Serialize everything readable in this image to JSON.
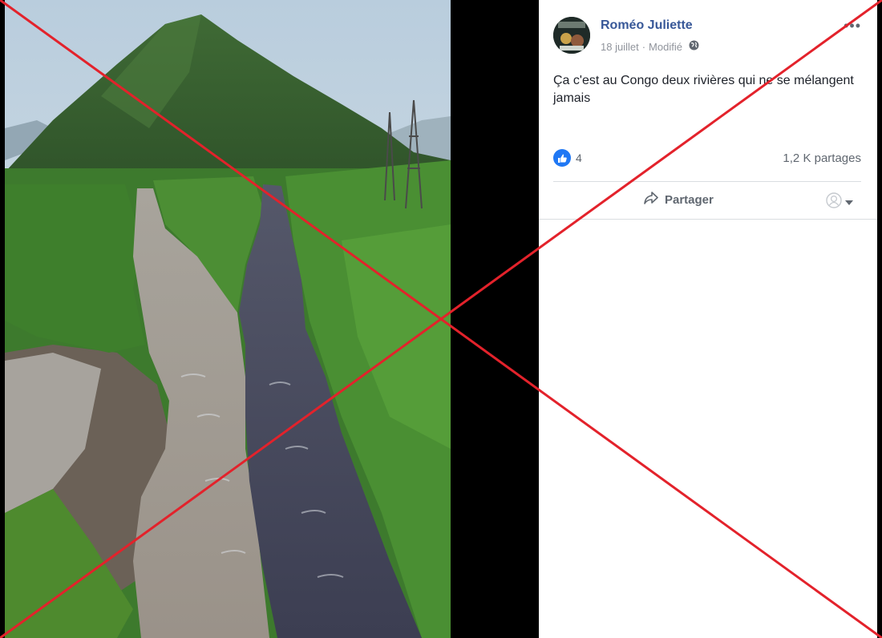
{
  "post": {
    "author": "Roméo Juliette",
    "date": "18 juillet",
    "separator": "·",
    "edited": "Modifié",
    "privacy_icon": "globe-icon",
    "more_label": "•••",
    "text": "Ça c'est au Congo deux rivières qui ne se mélangent jamais",
    "reaction_icon": "like-icon",
    "reaction_count": "4",
    "shares": "1,2 K partages",
    "share_button": "Partager"
  },
  "colors": {
    "author_link": "#385898",
    "like_blue": "#2078f4",
    "cross_red": "#e3222b",
    "muted_text": "#606770"
  }
}
